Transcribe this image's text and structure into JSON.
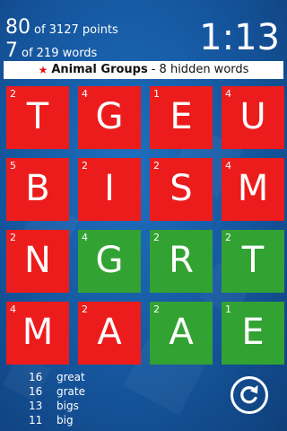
{
  "score": {
    "points": "80",
    "points_suffix": "of 3127 points",
    "words": "7",
    "words_suffix": "of 219 words"
  },
  "timer": "1:13",
  "banner": {
    "star": "★",
    "category": "Animal Groups",
    "hidden": "- 8 hidden words"
  },
  "tiles": [
    {
      "points": "2",
      "letter": "T",
      "color": "red"
    },
    {
      "points": "4",
      "letter": "G",
      "color": "red"
    },
    {
      "points": "1",
      "letter": "E",
      "color": "red"
    },
    {
      "points": "4",
      "letter": "U",
      "color": "red"
    },
    {
      "points": "5",
      "letter": "B",
      "color": "red"
    },
    {
      "points": "2",
      "letter": "I",
      "color": "red"
    },
    {
      "points": "2",
      "letter": "S",
      "color": "red"
    },
    {
      "points": "4",
      "letter": "M",
      "color": "red"
    },
    {
      "points": "2",
      "letter": "N",
      "color": "red"
    },
    {
      "points": "4",
      "letter": "G",
      "color": "green"
    },
    {
      "points": "2",
      "letter": "R",
      "color": "green"
    },
    {
      "points": "2",
      "letter": "T",
      "color": "green"
    },
    {
      "points": "4",
      "letter": "M",
      "color": "red"
    },
    {
      "points": "2",
      "letter": "A",
      "color": "red"
    },
    {
      "points": "2",
      "letter": "A",
      "color": "green"
    },
    {
      "points": "1",
      "letter": "E",
      "color": "green"
    }
  ],
  "found_words": [
    {
      "points": "16",
      "word": "great"
    },
    {
      "points": "16",
      "word": "grate"
    },
    {
      "points": "13",
      "word": "bigs"
    },
    {
      "points": "11",
      "word": "big"
    }
  ],
  "colors": {
    "red_tile": "#ec1c1c",
    "green_tile": "#32a233",
    "background": "#15569e"
  },
  "icons": {
    "restart": "restart-icon"
  }
}
